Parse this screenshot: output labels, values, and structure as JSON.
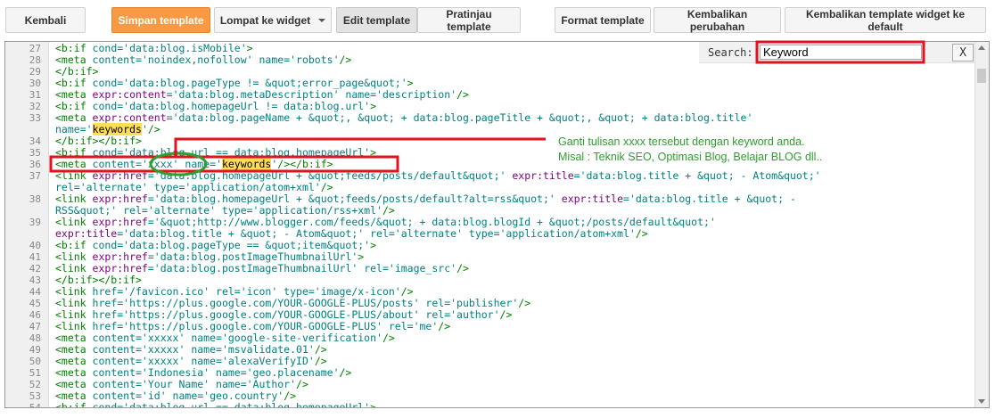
{
  "toolbar": {
    "back": "Kembali",
    "save": "Simpan template",
    "jump": "Lompat ke widget",
    "edit": "Edit template",
    "preview": "Pratinjau template",
    "format": "Format template",
    "revert": "Kembalikan perubahan",
    "revert_widget": "Kembalikan template widget ke default"
  },
  "search": {
    "label": "Search:",
    "value": "Keyword",
    "close": "X"
  },
  "annotation": {
    "line1": "Ganti tulisan xxxx tersebut dengan keyword anda.",
    "line2": "Misal : Teknik SEO, Optimasi Blog, Belajar BLOG dll.."
  },
  "code_lines": [
    {
      "n": "27",
      "segs": [
        {
          "c": "t",
          "s": "<b:if"
        },
        {
          "c": "a",
          "s": " cond='data:blog.isMobile'"
        },
        {
          "c": "t",
          "s": ">"
        }
      ]
    },
    {
      "n": "28",
      "segs": [
        {
          "c": "t",
          "s": "<meta"
        },
        {
          "c": "a",
          "s": " content='noindex,nofollow' name='robots'"
        },
        {
          "c": "t",
          "s": "/>"
        }
      ]
    },
    {
      "n": "29",
      "segs": [
        {
          "c": "t",
          "s": "</b:if>"
        }
      ]
    },
    {
      "n": "30",
      "segs": [
        {
          "c": "t",
          "s": "<b:if"
        },
        {
          "c": "a",
          "s": " cond='data:blog.pageType != &quot;error_page&quot;'"
        },
        {
          "c": "t",
          "s": ">"
        }
      ]
    },
    {
      "n": "31",
      "segs": [
        {
          "c": "t",
          "s": "<meta"
        },
        {
          "c": "k",
          "s": " expr:content"
        },
        {
          "c": "a",
          "s": "='data:blog.metaDescription' name='description'"
        },
        {
          "c": "t",
          "s": "/>"
        }
      ]
    },
    {
      "n": "32",
      "segs": [
        {
          "c": "t",
          "s": "<b:if"
        },
        {
          "c": "a",
          "s": " cond='data:blog.homepageUrl != data:blog.url'"
        },
        {
          "c": "t",
          "s": ">"
        }
      ]
    },
    {
      "n": "33",
      "segs": [
        {
          "c": "t",
          "s": "<meta"
        },
        {
          "c": "k",
          "s": " expr:content"
        },
        {
          "c": "a",
          "s": "='data:blog.pageName + &quot;, &quot; + data:blog.pageTitle + &quot;, &quot; + data:blog.title'"
        }
      ]
    },
    {
      "n": "",
      "segs": [
        {
          "c": "a",
          "s": "name='"
        },
        {
          "c": "h",
          "s": "keywords"
        },
        {
          "c": "a",
          "s": "'"
        },
        {
          "c": "t",
          "s": "/>"
        }
      ]
    },
    {
      "n": "34",
      "segs": [
        {
          "c": "t",
          "s": "</b:if></b:if>"
        }
      ]
    },
    {
      "n": "35",
      "segs": [
        {
          "c": "t",
          "s": "<b:if"
        },
        {
          "c": "a",
          "s": " cond='data:blog.url == data:blog.homepageUrl'"
        },
        {
          "c": "t",
          "s": ">"
        }
      ]
    },
    {
      "n": "36",
      "segs": [
        {
          "c": "t",
          "s": "<meta"
        },
        {
          "c": "a",
          "s": " content='xxxx' name='"
        },
        {
          "c": "h",
          "s": "keywords"
        },
        {
          "c": "a",
          "s": "'"
        },
        {
          "c": "t",
          "s": "/></b:if>"
        }
      ]
    },
    {
      "n": "37",
      "segs": [
        {
          "c": "t",
          "s": "<link"
        },
        {
          "c": "k",
          "s": " expr:href"
        },
        {
          "c": "a",
          "s": "='data:blog.homepageUrl + &quot;feeds/posts/default&quot;'"
        },
        {
          "c": "k",
          "s": " expr:title"
        },
        {
          "c": "a",
          "s": "='data:blog.title + &quot; - Atom&quot;'"
        }
      ]
    },
    {
      "n": "",
      "segs": [
        {
          "c": "a",
          "s": "rel='alternate' type='application/atom+xml'"
        },
        {
          "c": "t",
          "s": "/>"
        }
      ]
    },
    {
      "n": "38",
      "segs": [
        {
          "c": "t",
          "s": "<link"
        },
        {
          "c": "k",
          "s": " expr:href"
        },
        {
          "c": "a",
          "s": "='data:blog.homepageUrl + &quot;feeds/posts/default?alt=rss&quot;'"
        },
        {
          "c": "k",
          "s": " expr:title"
        },
        {
          "c": "a",
          "s": "='data:blog.title + &quot; -"
        }
      ]
    },
    {
      "n": "",
      "segs": [
        {
          "c": "a",
          "s": "RSS&quot;' rel='alternate' type='application/rss+xml'"
        },
        {
          "c": "t",
          "s": "/>"
        }
      ]
    },
    {
      "n": "39",
      "segs": [
        {
          "c": "t",
          "s": "<link"
        },
        {
          "c": "k",
          "s": " expr:href"
        },
        {
          "c": "a",
          "s": "='&quot;http://www.blogger.com/feeds/&quot; + data:blog.blogId + &quot;/posts/default&quot;'"
        }
      ]
    },
    {
      "n": "",
      "segs": [
        {
          "c": "k",
          "s": "expr:title"
        },
        {
          "c": "a",
          "s": "='data:blog.title + &quot; - Atom&quot;' rel='alternate' type='application/atom+xml'"
        },
        {
          "c": "t",
          "s": "/>"
        }
      ]
    },
    {
      "n": "40",
      "segs": [
        {
          "c": "t",
          "s": "<b:if"
        },
        {
          "c": "a",
          "s": " cond='data:blog.pageType == &quot;item&quot;'"
        },
        {
          "c": "t",
          "s": ">"
        }
      ]
    },
    {
      "n": "41",
      "segs": [
        {
          "c": "t",
          "s": "<link"
        },
        {
          "c": "k",
          "s": " expr:href"
        },
        {
          "c": "a",
          "s": "='data:blog.postImageThumbnailUrl'"
        },
        {
          "c": "t",
          "s": ">"
        }
      ]
    },
    {
      "n": "42",
      "segs": [
        {
          "c": "t",
          "s": "<link"
        },
        {
          "c": "k",
          "s": " expr:href"
        },
        {
          "c": "a",
          "s": "='data:blog.postImageThumbnailUrl' rel='image_src'"
        },
        {
          "c": "t",
          "s": "/>"
        }
      ]
    },
    {
      "n": "43",
      "segs": [
        {
          "c": "t",
          "s": "</b:if></b:if>"
        }
      ]
    },
    {
      "n": "44",
      "segs": [
        {
          "c": "t",
          "s": "<link"
        },
        {
          "c": "a",
          "s": " href='/favicon.ico' rel='icon' type='image/x-icon'"
        },
        {
          "c": "t",
          "s": "/>"
        }
      ]
    },
    {
      "n": "45",
      "segs": [
        {
          "c": "t",
          "s": "<link"
        },
        {
          "c": "a",
          "s": " href='https://plus.google.com/YOUR-GOOGLE-PLUS/posts' rel='publisher'"
        },
        {
          "c": "t",
          "s": "/>"
        }
      ]
    },
    {
      "n": "46",
      "segs": [
        {
          "c": "t",
          "s": "<link"
        },
        {
          "c": "a",
          "s": " href='https://plus.google.com/YOUR-GOOGLE-PLUS/about' rel='author'"
        },
        {
          "c": "t",
          "s": "/>"
        }
      ]
    },
    {
      "n": "47",
      "segs": [
        {
          "c": "t",
          "s": "<link"
        },
        {
          "c": "a",
          "s": " href='https://plus.google.com/YOUR-GOOGLE-PLUS' rel='me'"
        },
        {
          "c": "t",
          "s": "/>"
        }
      ]
    },
    {
      "n": "48",
      "segs": [
        {
          "c": "t",
          "s": "<meta"
        },
        {
          "c": "a",
          "s": " content='xxxxx' name='google-site-verification'"
        },
        {
          "c": "t",
          "s": "/>"
        }
      ]
    },
    {
      "n": "49",
      "segs": [
        {
          "c": "t",
          "s": "<meta"
        },
        {
          "c": "a",
          "s": " content='xxxxx' name='msvalidate.01'"
        },
        {
          "c": "t",
          "s": "/>"
        }
      ]
    },
    {
      "n": "50",
      "segs": [
        {
          "c": "t",
          "s": "<meta"
        },
        {
          "c": "a",
          "s": " content='xxxxx' name='alexaVerifyID'"
        },
        {
          "c": "t",
          "s": "/>"
        }
      ]
    },
    {
      "n": "51",
      "segs": [
        {
          "c": "t",
          "s": "<meta"
        },
        {
          "c": "a",
          "s": " content='Indonesia' name='geo.placename'"
        },
        {
          "c": "t",
          "s": "/>"
        }
      ]
    },
    {
      "n": "52",
      "segs": [
        {
          "c": "t",
          "s": "<meta"
        },
        {
          "c": "a",
          "s": " content='Your Name' name='Author'"
        },
        {
          "c": "t",
          "s": "/>"
        }
      ]
    },
    {
      "n": "53",
      "segs": [
        {
          "c": "t",
          "s": "<meta"
        },
        {
          "c": "a",
          "s": " content='id' name='geo.country'"
        },
        {
          "c": "t",
          "s": "/>"
        }
      ]
    },
    {
      "n": "54",
      "segs": [
        {
          "c": "t",
          "s": "<b:if"
        },
        {
          "c": "a",
          "s": " cond='data:blog.url == data:blog.homepageUrl'"
        },
        {
          "c": "t",
          "s": ">"
        }
      ]
    }
  ],
  "colors": {
    "tag": "#008000",
    "attr": "#008080",
    "expr": "#7f007f",
    "highlight": "#ffdd55",
    "annotation_red": "#e0141e",
    "annotation_green": "#2e9e2e",
    "save_button": "#f89a43"
  },
  "icons": {
    "dropdown": "chevron-down-icon",
    "scroll_up": "arrow-up-icon",
    "scroll_down": "arrow-down-icon"
  }
}
